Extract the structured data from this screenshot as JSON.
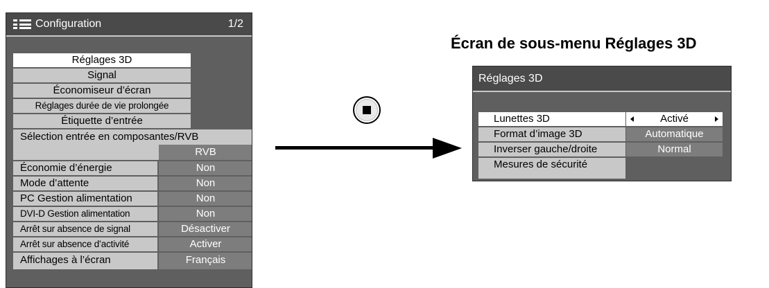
{
  "config_menu": {
    "title": "Configuration",
    "page": "1/2",
    "icon": "menu-list-icon",
    "items": [
      {
        "label": "Réglages 3D"
      },
      {
        "label": "Signal"
      },
      {
        "label": "Économiseur d’écran"
      },
      {
        "label": "Réglages durée de vie prolongée"
      },
      {
        "label": "Étiquette d’entrée"
      }
    ],
    "component_rgb": {
      "label": "Sélection entrée en composantes/RVB",
      "value": "RVB"
    },
    "settings": [
      {
        "label": "Économie d’énergie",
        "value": "Non"
      },
      {
        "label": "Mode d’attente",
        "value": "Non"
      },
      {
        "label": "PC Gestion alimentation",
        "value": "Non"
      },
      {
        "label": "DVI-D Gestion alimentation",
        "value": "Non"
      },
      {
        "label": "Arrêt sur absence de signal",
        "value": "Désactiver"
      },
      {
        "label": "Arrêt sur absence d’activité",
        "value": "Activer"
      },
      {
        "label": "Affichages à l’écran",
        "value": "Français"
      }
    ]
  },
  "transition": {
    "button_icon": "stop-square-icon"
  },
  "submenu": {
    "heading": "Écran de sous-menu Réglages 3D",
    "title": "Réglages 3D",
    "rows": [
      {
        "label": "Lunettes 3D",
        "value": "Activé"
      },
      {
        "label": "Format d’image 3D",
        "value": "Automatique"
      },
      {
        "label": "Inverser gauche/droite",
        "value": "Normal"
      },
      {
        "label": "Mesures de sécurité",
        "value": ""
      }
    ]
  },
  "colors": {
    "panel_bg": "#5f5f5f",
    "title_bg": "#4a4a4a",
    "item_bg": "#c8c8c8",
    "value_bg": "#7d7d7d",
    "selected_bg": "#ffffff"
  }
}
